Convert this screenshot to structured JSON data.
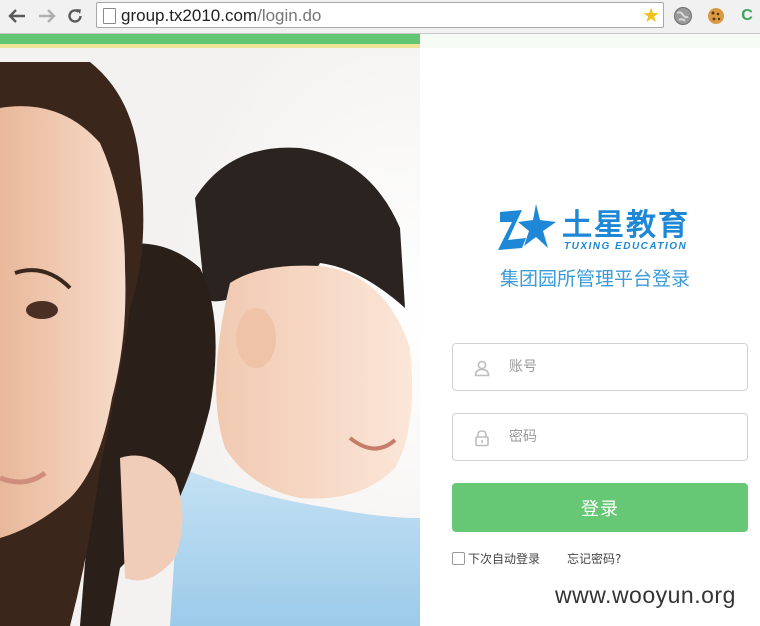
{
  "browser": {
    "url_host": "group.tx2010.com",
    "url_path": "/login.do",
    "extension_label": "C"
  },
  "brand": {
    "name_cn": "土星教育",
    "name_en": "TUXING EDUCATION",
    "color": "#1e88d6"
  },
  "login": {
    "title": "集团园所管理平台登录",
    "username_placeholder": "账号",
    "password_placeholder": "密码",
    "submit_label": "登录",
    "remember_label": "下次自动登录",
    "forgot_label": "忘记密码?",
    "accent_color": "#66c874"
  },
  "watermark": "www.wooyun.org"
}
